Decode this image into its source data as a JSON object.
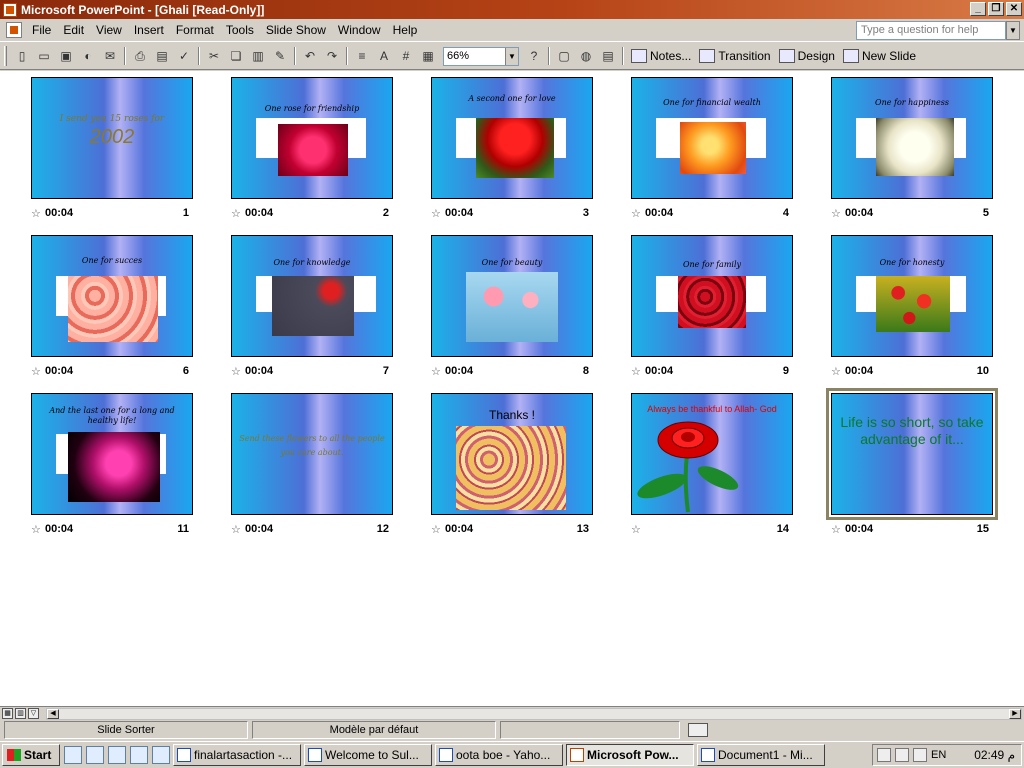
{
  "window": {
    "title": "Microsoft PowerPoint - [Ghali [Read-Only]]"
  },
  "menu": [
    "File",
    "Edit",
    "View",
    "Insert",
    "Format",
    "Tools",
    "Slide Show",
    "Window",
    "Help"
  ],
  "ask_placeholder": "Type a question for help",
  "toolbar": {
    "zoom": "66%",
    "notes": "Notes...",
    "transition": "Transition",
    "design": "Design",
    "new_slide": "New Slide"
  },
  "slides": [
    {
      "num": "1",
      "time": "00:04",
      "line1": "I send you 15 roses for",
      "line2": "2002"
    },
    {
      "num": "2",
      "time": "00:04",
      "caption": "One rose for friendship"
    },
    {
      "num": "3",
      "time": "00:04",
      "caption": "A second one for love"
    },
    {
      "num": "4",
      "time": "00:04",
      "caption": "One for financial wealth"
    },
    {
      "num": "5",
      "time": "00:04",
      "caption": "One for happiness"
    },
    {
      "num": "6",
      "time": "00:04",
      "caption": "One for succes"
    },
    {
      "num": "7",
      "time": "00:04",
      "caption": "One for knowledge"
    },
    {
      "num": "8",
      "time": "00:04",
      "caption": "One for beauty"
    },
    {
      "num": "9",
      "time": "00:04",
      "caption": "One for family"
    },
    {
      "num": "10",
      "time": "00:04",
      "caption": "One for honesty"
    },
    {
      "num": "11",
      "time": "00:04",
      "caption": "And the last one for a long and healthy life!"
    },
    {
      "num": "12",
      "time": "00:04",
      "caption": "Send these flowers to all the people you care about."
    },
    {
      "num": "13",
      "time": "00:04",
      "caption": "Thanks !"
    },
    {
      "num": "14",
      "time": "",
      "caption": "Always be thankful to Allah- God"
    },
    {
      "num": "15",
      "time": "00:04",
      "caption": "Life is so short, so take advantage of it..."
    }
  ],
  "status": {
    "view": "Slide Sorter",
    "design": "Modèle par défaut"
  },
  "taskbar": {
    "start": "Start",
    "tasks": [
      "finalartasaction -...",
      "Welcome to Sul...",
      "oota boe - Yaho...",
      "Microsoft Pow...",
      "Document1 - Mi..."
    ],
    "lang": "EN",
    "clock": "02:49",
    "clock_suffix": "م"
  },
  "colors": {
    "title_bar": "#b64316",
    "slide_gradient_edge": "#1bb2e8",
    "slide_gradient_center": "#b3b1f5",
    "selected_border": "#8a8464"
  }
}
